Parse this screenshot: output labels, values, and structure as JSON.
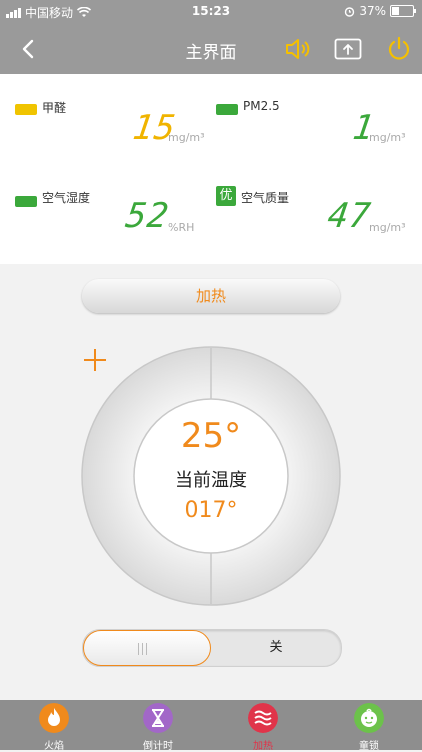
{
  "status": {
    "carrier": "中国移动",
    "time": "15:23",
    "battery": "37%",
    "battery_level": 0.37
  },
  "nav": {
    "title": "主界面",
    "back_icon": "chevron-left-icon",
    "speaker_icon": "speaker-icon",
    "upload_icon": "upload-box-icon",
    "power_icon": "power-icon"
  },
  "sensors": [
    {
      "name": "甲醛",
      "value": "15",
      "unit": "mg/m³",
      "color": "#f0b400"
    },
    {
      "name": "PM2.5",
      "value": "1",
      "unit": "mg/m³",
      "color": "#3ba83b"
    },
    {
      "name": "空气湿度",
      "value": "52",
      "unit": "%RH",
      "color": "#3ba83b"
    },
    {
      "name": "空气质量",
      "value": "47",
      "unit": "mg/m³",
      "color": "#3ba83b",
      "badge": "优"
    }
  ],
  "mode_button": {
    "label": "加热"
  },
  "dial": {
    "current_temp": "25°",
    "label": "当前温度",
    "target_temp": "017°"
  },
  "toggle": {
    "state": "关"
  },
  "tabs": [
    {
      "label": "火焰",
      "color": "#f08a1c",
      "icon": "flame-icon"
    },
    {
      "label": "倒计时",
      "color": "#a267c8",
      "icon": "hourglass-icon"
    },
    {
      "label": "加热",
      "color": "#e0344a",
      "icon": "heat-waves-icon"
    },
    {
      "label": "童锁",
      "color": "#6cc24a",
      "icon": "child-face-icon"
    }
  ],
  "colors": {
    "accent": "#f08a1c",
    "header": "#9a9a9a",
    "green": "#3ba83b",
    "yellow": "#f0b400"
  }
}
